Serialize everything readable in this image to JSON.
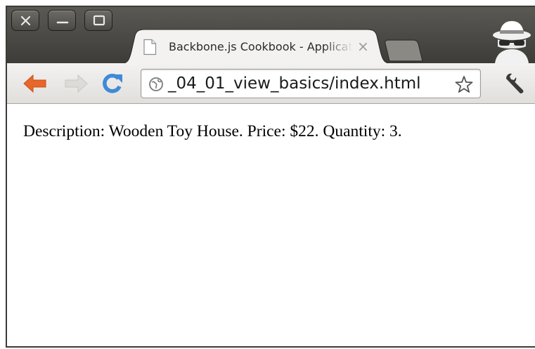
{
  "window": {
    "controls": {
      "close_icon": "close-icon",
      "minimize_icon": "minimize-icon",
      "maximize_icon": "maximize-icon"
    }
  },
  "tab": {
    "title": "Backbone.js Cookbook - Application",
    "close_glyph": "×",
    "icon": "page-icon"
  },
  "new_tab": {
    "icon": "new-tab-icon"
  },
  "incognito": {
    "icon": "incognito-icon"
  },
  "toolbar": {
    "back_icon": "back-arrow-icon",
    "forward_icon": "forward-arrow-icon",
    "reload_icon": "reload-icon",
    "wrench_icon": "wrench-icon"
  },
  "omnibox": {
    "url": "_04_01_view_basics/index.html",
    "site_icon": "globe-icon",
    "bookmark_icon": "star-icon"
  },
  "page": {
    "text": "Description: Wooden Toy House. Price: $22. Quantity: 3."
  },
  "colors": {
    "titlebar": "#3d3c38",
    "back_arrow": "#e8672a",
    "reload": "#3f8ad8",
    "toolbar": "#e8e6e3"
  }
}
